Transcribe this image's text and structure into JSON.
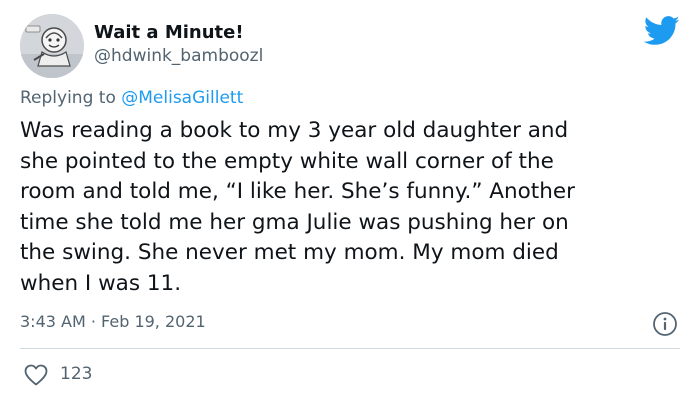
{
  "tweet": {
    "display_name": "Wait a Minute!",
    "handle": "@hdwink_bamboozl",
    "reply_prefix": "Replying to ",
    "reply_to": "@MelisaGillett",
    "body_lines": [
      "Was reading a book to my 3 year old daughter and",
      "she pointed to the empty white wall corner of the",
      "room and told me, “I like her. She’s funny.” Another",
      "time she told me her gma Julie was pushing her on",
      "the swing. She never met my mom. My mom died",
      "when I was 11."
    ],
    "timestamp": "3:43 AM · Feb 19, 2021",
    "like_count": "123"
  },
  "icons": {
    "brand": "twitter-bird-icon",
    "info": "info-icon",
    "like": "heart-icon"
  },
  "colors": {
    "brand_blue": "#1d9bf0",
    "text_primary": "#0f1419",
    "text_secondary": "#536471",
    "divider": "#cfd9de"
  }
}
